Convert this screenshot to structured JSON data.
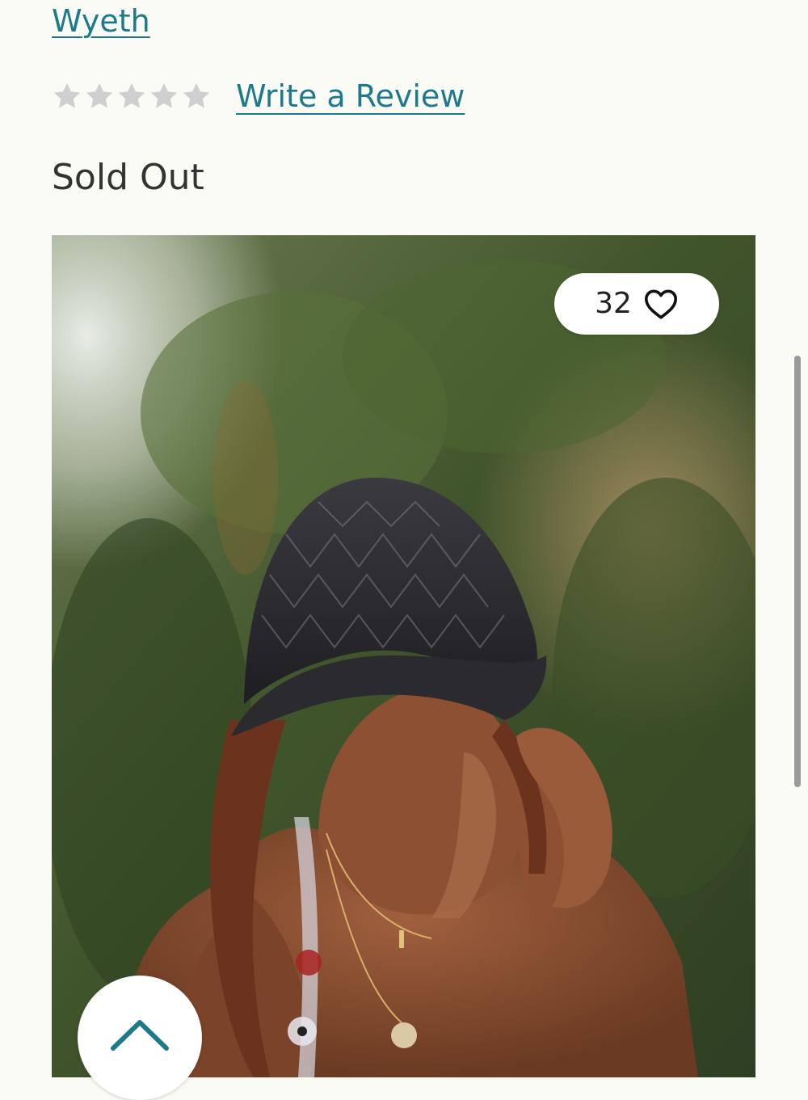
{
  "product": {
    "brand": "Wyeth",
    "rating_stars": 0,
    "rating_max": 5,
    "review_link": "Write a Review",
    "status": "Sold Out"
  },
  "image": {
    "like_count": "32"
  },
  "icons": {
    "rating": "star-icon",
    "like": "heart-icon",
    "scroll_top": "chevron-up-icon"
  },
  "colors": {
    "link": "#1d7a8c",
    "star_empty": "#cfcfcf",
    "text": "#333333",
    "background": "#fbfbf6"
  }
}
